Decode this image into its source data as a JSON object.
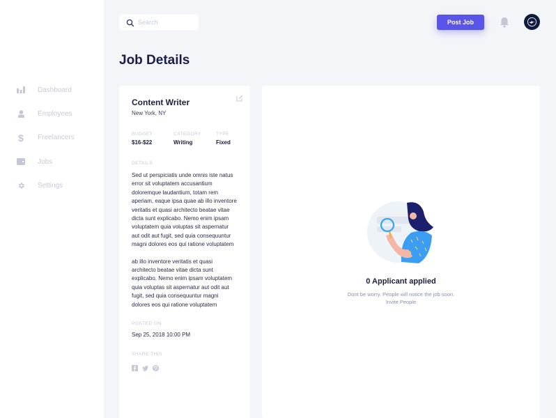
{
  "sidebar": {
    "items": [
      {
        "label": "Dashboard",
        "icon": "bar-chart-icon"
      },
      {
        "label": "Employees",
        "icon": "user-icon"
      },
      {
        "label": "Freelancers",
        "icon": "dollar-icon"
      },
      {
        "label": "Jobs",
        "icon": "wallet-icon"
      },
      {
        "label": "Settings",
        "icon": "gear-icon"
      }
    ]
  },
  "header": {
    "search_placeholder": "Search",
    "post_job_label": "Post Job",
    "accent_color": "#5a55ea"
  },
  "page": {
    "title": "Job Details"
  },
  "job": {
    "title": "Content Writer",
    "location": "New York, NY",
    "budget_label": "BUDGET",
    "budget": "$16-$22",
    "category_label": "CATEGORY",
    "category": "Writing",
    "type_label": "TYPE",
    "type": "Fixed",
    "details_label": "DETAILS",
    "details_p1": "Sed ut perspiciatis unde omnis iste natus error sit voluptatem accusantium doloremque laudantium, totam rem aperiam, eaque ipsa quae ab illo inventore veritatis et quasi architecto beatae vitae dicta sunt explicabo. Nemo enim ipsam voluptatem quia voluptas sit aspernatur aut odit aut fugit, sed quia consequuntur magni dolores eos qui ratione voluptatem",
    "details_p2": "ab illo inventore veritatis et quasi architecto beatae vitae dicta sunt explicabo. Nemo enim ipsam voluptatem quia voluptas sit aspernatur aut odit aut fugit, sed quia consequuntur magni dolores eos qui ratione voluptatem",
    "posted_label": "POSTED ON",
    "posted_on": "Sep 25, 2018 10:00 PM",
    "share_label": "SHARE THIS",
    "share": [
      "facebook-icon",
      "twitter-icon",
      "pinterest-icon"
    ]
  },
  "applicants": {
    "title": "0 Applicant applied",
    "subtitle": "Dont be worry. People will notice the job soon. Invite People"
  }
}
